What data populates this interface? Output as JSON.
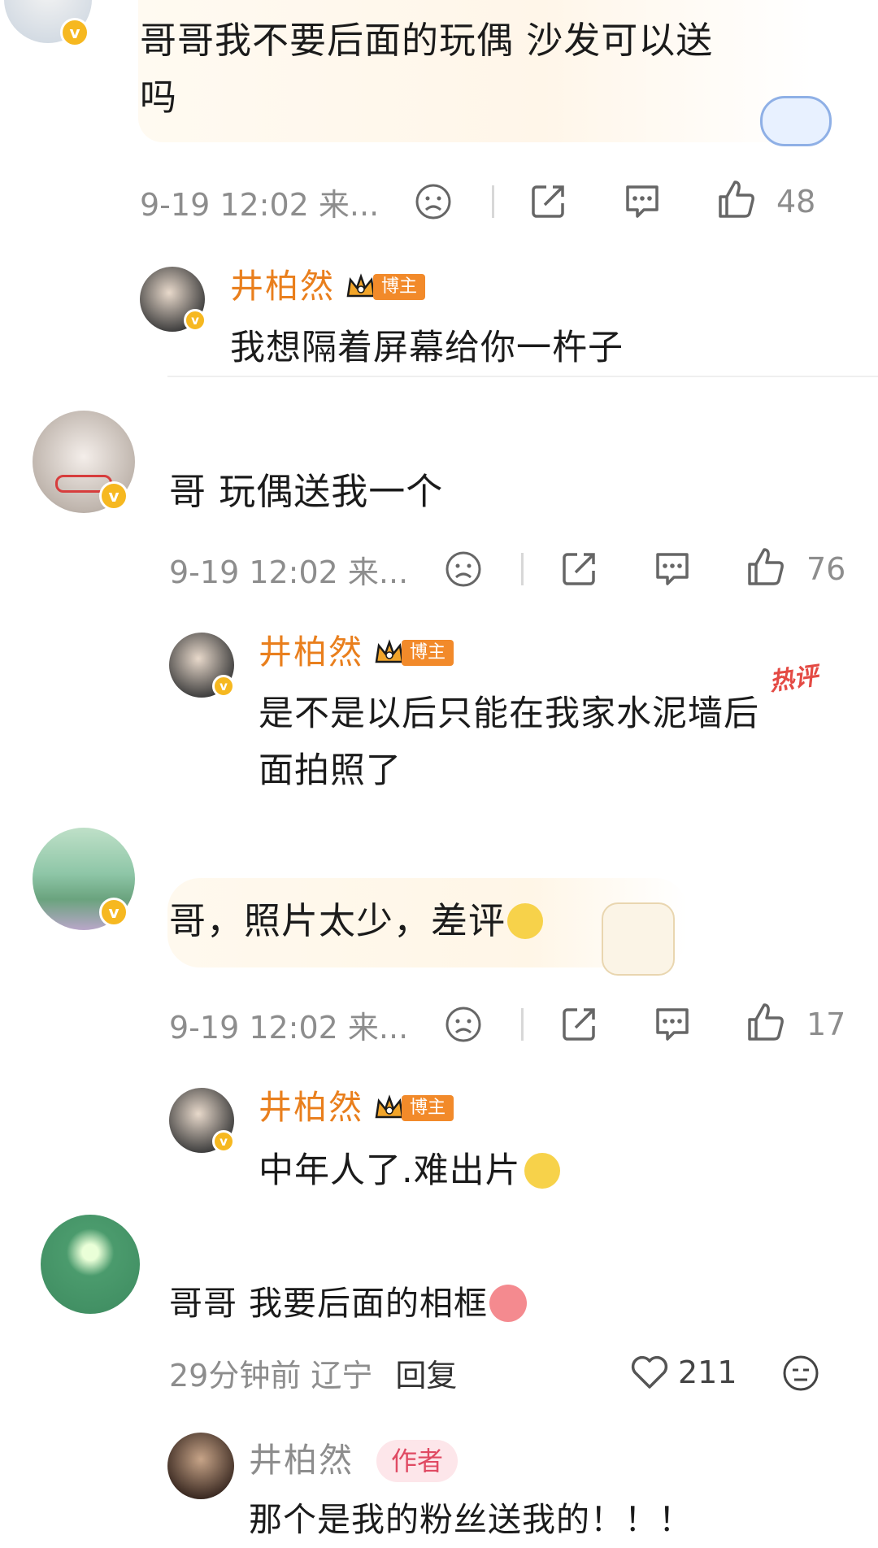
{
  "comments": [
    {
      "text": "哥哥我不要后面的玩偶 沙发可以送吗",
      "text_line1": "哥哥我不要后面的玩偶 沙发可以送",
      "text_line2": "吗",
      "timestamp": "9-19 12:02 来...",
      "likes": "48",
      "reply": {
        "user": "井柏然",
        "badge": "博主",
        "text": "我想隔着屏幕给你一杵子"
      }
    },
    {
      "text": "哥 玩偶送我一个",
      "timestamp": "9-19 12:02 来...",
      "likes": "76",
      "reply": {
        "user": "井柏然",
        "badge": "博主",
        "hot_label": "热评",
        "text_line1": "是不是以后只能在我家水泥墙后",
        "text_line2": "面拍照了"
      }
    },
    {
      "text": "哥，照片太少，差评",
      "timestamp": "9-19 12:02 来...",
      "likes": "17",
      "reply": {
        "user": "井柏然",
        "badge": "博主",
        "text": "中年人了.难出片"
      }
    },
    {
      "text": "哥哥 我要后面的相框",
      "time": "29分钟前",
      "location": "辽宁",
      "reply_label": "回复",
      "likes": "211",
      "reply": {
        "user": "井柏然",
        "badge": "作者",
        "text": "那个是我的粉丝送我的！！！"
      }
    }
  ],
  "colors": {
    "username": "#e97f1d",
    "badge": "#f28a2a",
    "verified": "#f6b820",
    "author_tag_bg": "#fde6ea",
    "author_tag_text": "#e04a63"
  }
}
